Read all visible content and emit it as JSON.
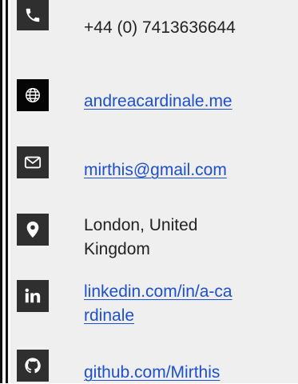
{
  "contacts": [
    {
      "type": "phone",
      "icon": "phone-icon",
      "text": "+44 (0) 7413636644"
    },
    {
      "type": "website",
      "icon": "globe-icon",
      "text": "andreacardinale.me"
    },
    {
      "type": "email",
      "icon": "mail-icon",
      "text": "mirthis@gmail.com"
    },
    {
      "type": "location",
      "icon": "location-pin-icon",
      "line1": "London, United",
      "line2": "Kingdom"
    },
    {
      "type": "linkedin",
      "icon": "linkedin-icon",
      "line1": "linkedin.com/in/a-ca",
      "line2": "rdinale"
    },
    {
      "type": "github",
      "icon": "github-icon",
      "text": "github.com/Mirthis"
    }
  ],
  "colors": {
    "background": "#efefef",
    "icon_box": "#2f2f2f",
    "link": "#1d4fd1",
    "text": "#222222"
  }
}
